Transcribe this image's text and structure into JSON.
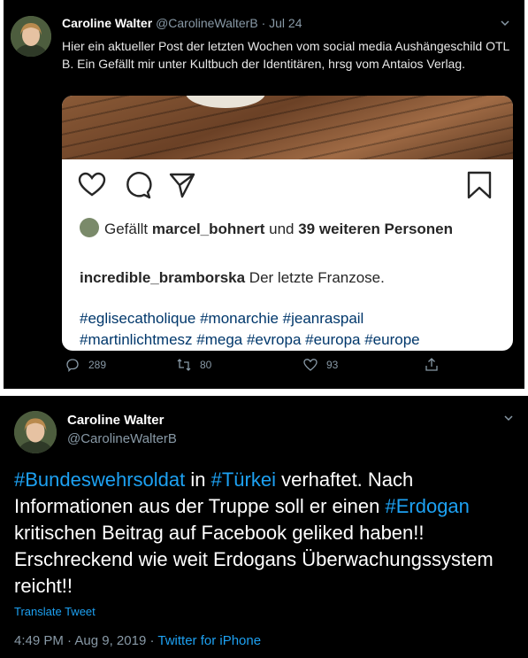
{
  "tweet1": {
    "name": "Caroline Walter",
    "handle": "@CarolineWalterB",
    "sep": "·",
    "date": "Jul 24",
    "text": "Hier ein aktueller Post der letzten Wochen vom social media Aushängeschild OTL B. Ein Gefällt mir unter Kultbuch der Identitären, hrsg vom Antaios Verlag.",
    "instagram": {
      "likes_prefix": "Gefällt ",
      "likes_user": "marcel_bohnert",
      "likes_mid": " und ",
      "likes_count": "39 weiteren Personen",
      "caption_user": "incredible_bramborska",
      "caption_text": " Der letzte Franzose.",
      "hashtags_line1": "#eglisecatholique #monarchie #jeanraspail",
      "hashtags_line2": "#martinlichtmesz #mega #evropa #europa #europe"
    },
    "actions": {
      "replies": "289",
      "retweets": "80",
      "likes": "93"
    }
  },
  "tweet2": {
    "name": "Caroline Walter",
    "handle": "@CarolineWalterB",
    "text_parts": {
      "tag1": "#Bundeswehrsoldat",
      "t1": " in ",
      "tag2": "#Türkei",
      "t2": " verhaftet. Nach Informationen aus der Truppe soll er einen ",
      "tag3": "#Erdogan",
      "t3": " kritischen Beitrag auf Facebook geliked haben!! Erschreckend wie weit Erdogans Überwachungssystem reicht!!"
    },
    "translate_label": "Translate Tweet",
    "time": "4:49 PM",
    "sep": " · ",
    "date": "Aug 9, 2019",
    "source": "Twitter for iPhone"
  },
  "colors": {
    "background": "#000000",
    "link": "#1da1f2",
    "muted": "#8899a6",
    "instagram_tag": "#00376b"
  }
}
